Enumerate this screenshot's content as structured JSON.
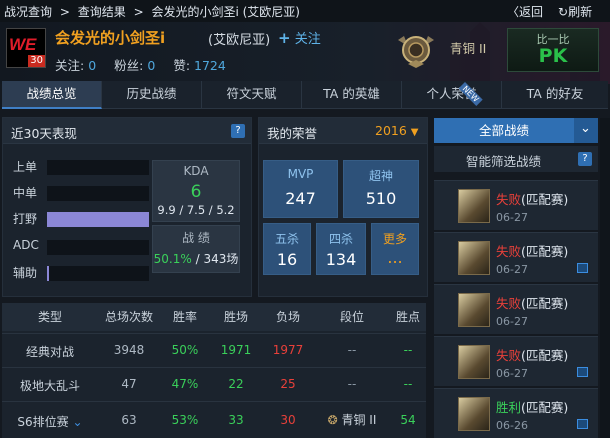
{
  "crumbs": [
    "战况查询",
    ">",
    "查询结果",
    ">",
    "会发光的小剑圣i (艾欧尼亚)"
  ],
  "nav": {
    "back": "〈返回",
    "refresh": "刷新"
  },
  "player": {
    "avatar_logo": "WE",
    "level": "30",
    "name": "会发光的小剑圣i",
    "server": "(艾欧尼亚)",
    "follow": "关注",
    "follow_label": "关注:",
    "follow_count": "0",
    "fans_label": "粉丝:",
    "fans_count": "0",
    "likes_label": "赞:",
    "likes_count": "1724"
  },
  "rank": {
    "name": "青铜 II"
  },
  "pk": {
    "top": "比一比",
    "label": "PK"
  },
  "tabs": [
    {
      "label": "战绩总览",
      "active": true
    },
    {
      "label": "历史战绩",
      "active": false
    },
    {
      "label": "符文天赋",
      "active": false
    },
    {
      "label": "TA 的英雄",
      "active": false
    },
    {
      "label": "个人荣誉",
      "active": false,
      "badge": "NEW"
    },
    {
      "label": "TA 的好友",
      "active": false
    }
  ],
  "recent": {
    "title": "近30天表现",
    "help": "?",
    "lanes": [
      {
        "label": "上单",
        "value": 0
      },
      {
        "label": "中单",
        "value": 0
      },
      {
        "label": "打野",
        "value": 1
      },
      {
        "label": "ADC",
        "value": 0
      },
      {
        "label": "辅助",
        "value": 0.02
      }
    ],
    "kda_title": "KDA",
    "kda_value": "6",
    "kda_detail": "9.9 / 7.5 / 5.2",
    "record_title": "战 绩",
    "winrate": "50.1%",
    "games": "/ 343场"
  },
  "honor": {
    "title": "我的荣誉",
    "year": "2016",
    "cards": [
      {
        "label": "MVP",
        "value": "247"
      },
      {
        "label": "超神",
        "value": "510"
      },
      {
        "label": "五杀",
        "value": "16"
      },
      {
        "label": "四杀",
        "value": "134"
      },
      {
        "label": "更多",
        "value": "..."
      }
    ]
  },
  "table": {
    "headers": [
      "类型",
      "总场次数",
      "胜率",
      "胜场",
      "负场",
      "段位",
      "胜点"
    ],
    "rows": [
      {
        "type": "经典对战",
        "total": "3948",
        "rate": "50%",
        "win": "1971",
        "lose": "1977",
        "rank": "--",
        "pts": "--"
      },
      {
        "type": "极地大乱斗",
        "total": "47",
        "rate": "47%",
        "win": "22",
        "lose": "25",
        "rank": "--",
        "pts": "--"
      },
      {
        "type": "S6排位赛",
        "total": "63",
        "rate": "53%",
        "win": "33",
        "lose": "30",
        "rank": "青铜 II",
        "pts": "54"
      }
    ]
  },
  "matches": {
    "all_label": "全部战绩",
    "smart_label": "智能筛选战绩",
    "items": [
      {
        "result": "失败",
        "mode": "(匹配赛)",
        "date": "06-27",
        "video": false
      },
      {
        "result": "失败",
        "mode": "(匹配赛)",
        "date": "06-27",
        "video": true
      },
      {
        "result": "失败",
        "mode": "(匹配赛)",
        "date": "06-27",
        "video": false
      },
      {
        "result": "失败",
        "mode": "(匹配赛)",
        "date": "06-27",
        "video": true
      },
      {
        "result": "胜利",
        "mode": "(匹配赛)",
        "date": "06-26",
        "video": true
      }
    ]
  },
  "colors": {
    "accent": "#2f6fb3",
    "win": "#3ad05a",
    "lose": "#e8403a",
    "gold": "#f0a020"
  }
}
